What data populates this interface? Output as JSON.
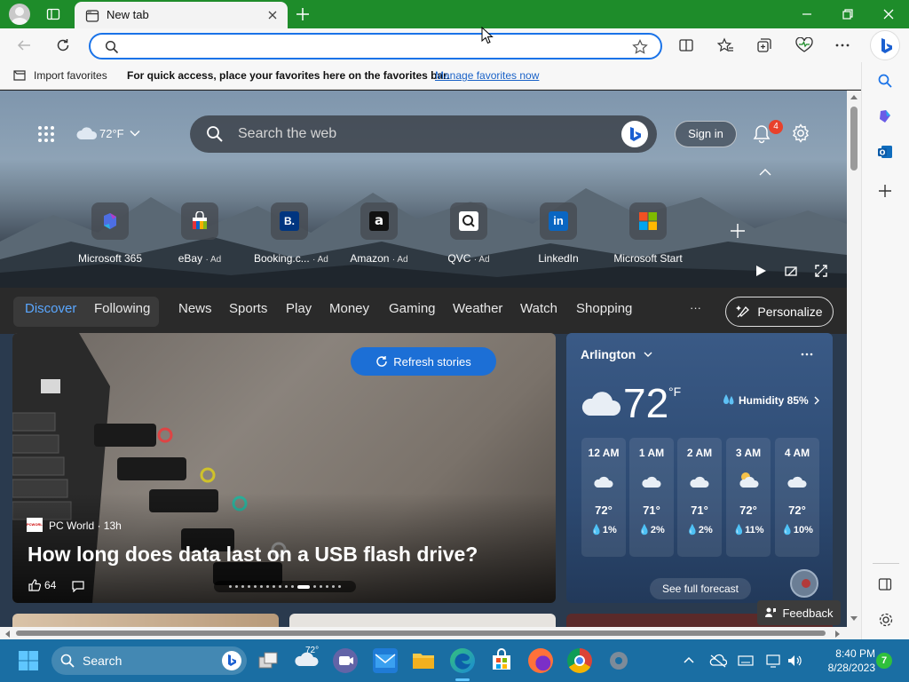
{
  "browser": {
    "tab_title": "New tab",
    "address_value": "",
    "favbar": {
      "import_label": "Import favorites",
      "prompt": "For quick access, place your favorites here on the favorites bar.",
      "manage_link": "Manage favorites now"
    }
  },
  "newtab": {
    "weather_chip": "72°F",
    "search_placeholder": "Search the web",
    "sign_in": "Sign in",
    "notification_count": "4",
    "quicklinks": [
      {
        "name": "Microsoft 365",
        "ad": ""
      },
      {
        "name": "eBay",
        "ad": "· Ad"
      },
      {
        "name": "Booking.c...",
        "ad": "· Ad"
      },
      {
        "name": "Amazon",
        "ad": "· Ad"
      },
      {
        "name": "QVC",
        "ad": "· Ad"
      },
      {
        "name": "LinkedIn",
        "ad": ""
      },
      {
        "name": "Microsoft Start",
        "ad": ""
      }
    ],
    "nav": {
      "items": [
        "Discover",
        "Following",
        "News",
        "Sports",
        "Play",
        "Money",
        "Gaming",
        "Weather",
        "Watch",
        "Shopping"
      ],
      "more": "···",
      "personalize": "Personalize"
    },
    "story": {
      "refresh": "Refresh stories",
      "source": "PC World · 13h",
      "source_logo": "PCWORLD",
      "headline": "How long does data last on a USB flash drive?",
      "likes": "64"
    },
    "weather": {
      "city": "Arlington",
      "temp": "72",
      "unit": "°F",
      "humidity": "Humidity 85%",
      "hours": [
        {
          "time": "12 AM",
          "temp": "72°",
          "precip": "1%"
        },
        {
          "time": "1 AM",
          "temp": "71°",
          "precip": "2%"
        },
        {
          "time": "2 AM",
          "temp": "71°",
          "precip": "2%"
        },
        {
          "time": "3 AM",
          "temp": "72°",
          "precip": "11%"
        },
        {
          "time": "4 AM",
          "temp": "72°",
          "precip": "10%"
        }
      ],
      "see_forecast": "See full forecast"
    },
    "feedback": "Feedback"
  },
  "taskbar": {
    "search_label": "Search",
    "weather_temp": "72°",
    "time": "8:40 PM",
    "date": "8/28/2023",
    "notifications": "7"
  },
  "colors": {
    "titlebar": "#1e8c2a",
    "accent": "#1a73e8",
    "taskbar": "#1a6ea3",
    "refresh_button": "#1c6fd6"
  }
}
